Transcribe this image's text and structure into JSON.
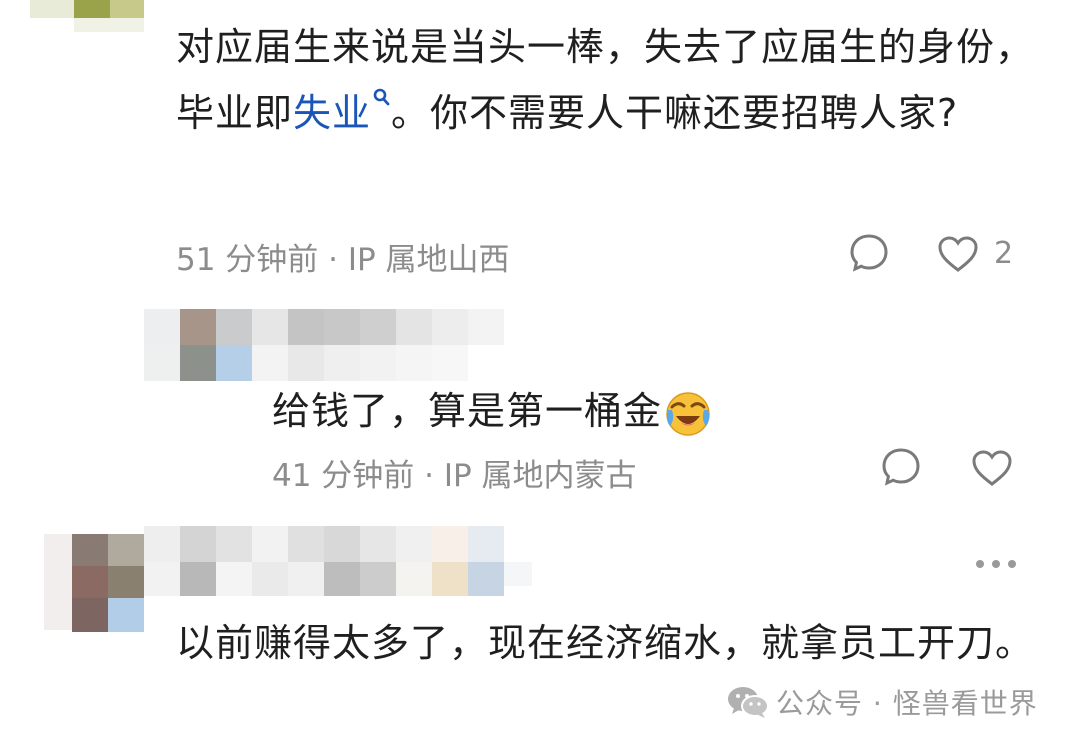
{
  "comments": [
    {
      "text_before_link": "对应届生来说是当头一棒，失去了应届生的身份，毕业即",
      "link_text": "失业",
      "text_after_link": "。你不需要人干嘛还要招聘人家?",
      "meta": "51 分钟前 · IP 属地山西",
      "like_count": "2"
    },
    {
      "reply_text": "给钱了，算是第一桶金",
      "reply_meta": "41 分钟前 · IP 属地内蒙古"
    },
    {
      "text": "以前赚得太多了，现在经济缩水，就拿员工开刀。"
    }
  ],
  "watermark": {
    "text": "公众号 · 怪兽看世界"
  },
  "colors": {
    "link": "#1a55b8",
    "meta": "#8c8c8c",
    "text": "#1f1f1f"
  },
  "icons": [
    "search-icon",
    "comment-icon",
    "heart-icon",
    "more-icon",
    "cry-laugh-emoji",
    "wechat-icon"
  ]
}
